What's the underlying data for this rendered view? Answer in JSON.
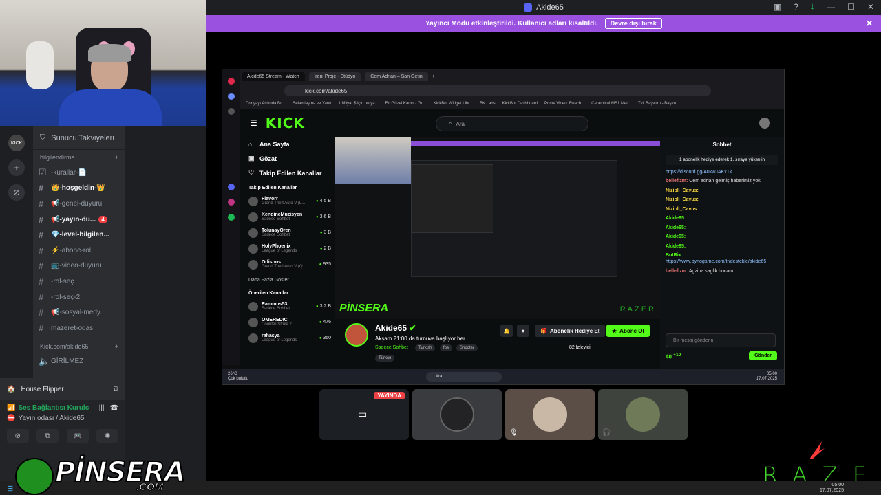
{
  "window": {
    "title": "Akide65"
  },
  "banner": {
    "text": "Yayıncı Modu etkinleştirildi. Kullanıcı adları kısaltıldı.",
    "button": "Devre dışı bırak"
  },
  "server": {
    "boost_label": "Sunucu Takviyeleri",
    "category1": "bilgilendirme",
    "category2": "Kick.com/akide65",
    "channels": [
      {
        "icon": "☑",
        "name": "-kurallar-📄",
        "bold": false
      },
      {
        "icon": "#",
        "name": "👑-hoşgeldin-👑",
        "bold": true
      },
      {
        "icon": "#",
        "name": "📢-genel-duyuru",
        "bold": false
      },
      {
        "icon": "#",
        "name": "📢-yayın-du...",
        "bold": true,
        "badge": "4"
      },
      {
        "icon": "#",
        "name": "💎-level-bilgilen...",
        "bold": true
      },
      {
        "icon": "#",
        "name": "⚡-abone-rol",
        "bold": false
      },
      {
        "icon": "#",
        "name": "📺-video-duyuru",
        "bold": false
      },
      {
        "icon": "#",
        "name": "-rol-seç",
        "bold": false
      },
      {
        "icon": "#",
        "name": "-rol-seç-2",
        "bold": false
      },
      {
        "icon": "#",
        "name": "📢-sosyal-medy...",
        "bold": false
      },
      {
        "icon": "#",
        "name": "mazeret-odası",
        "bold": false
      }
    ],
    "voice_channel": "GİRİLMEZ"
  },
  "voice_panel": {
    "activity": "House Flipper",
    "status": "Ses Bağlantısı Kurulc",
    "room": "Yayın odası / Akide65"
  },
  "browser": {
    "tabs": [
      "Akide65 Stream - Watch",
      "Yeni Proje - Stüdyo",
      "Cem Adrian – San Getin"
    ],
    "url": "kick.com/akide65",
    "bookmarks": [
      "Dunyayı Ardında Bır...",
      "Selamlaşma ve Yanıt",
      "1 Milyar $ için ne ya...",
      "En Güzel Kadın - Gu...",
      "KickBot Widget Libr...",
      "BK Labs",
      "KickBot Dashboard",
      "Prime Video: Reach...",
      "Ceramical MS1 Met...",
      "Tvll Başvuru - Başvu..."
    ]
  },
  "kick": {
    "logo": "KICK",
    "search_placeholder": "Ara",
    "nav": [
      "Ana Sayfa",
      "Gözat",
      "Takip Edilen Kanallar"
    ],
    "followed_title": "Takip Edilen Kanallar",
    "followed": [
      {
        "name": "Flavorr",
        "game": "Grand Theft Auto V (L...",
        "viewers": "4,5 B"
      },
      {
        "name": "KendineMuzisyen",
        "game": "Sadece Sohbet",
        "viewers": "3,6 B"
      },
      {
        "name": "TolunayOren",
        "game": "Sadece Sohbet",
        "viewers": "3 B"
      },
      {
        "name": "HolyPhoenix",
        "game": "League of Legends",
        "viewers": "2 B"
      },
      {
        "name": "Odisnos",
        "game": "Grand Theft Auto V (Q...",
        "viewers": "935"
      }
    ],
    "show_more": "Daha Fazla Göster",
    "recommended_title": "Önerilen Kanallar",
    "recommended": [
      {
        "name": "Rammus53",
        "game": "Sadece Sohbet",
        "viewers": "3,2 B"
      },
      {
        "name": "OMEREDIC",
        "game": "Counter-Strike 2",
        "viewers": "476"
      },
      {
        "name": "rahasya",
        "game": "League of Legends",
        "viewers": "360"
      }
    ],
    "stream": {
      "name": "Akide65",
      "title": "Akşam 21:00 da turnuva başlıyor her...",
      "category": "Sadece Sohbet",
      "tags": [
        "Turkish",
        "fps",
        "Shooter",
        "Türkçe"
      ],
      "gift_button": "Abonelik Hediye Et",
      "sub_button": "Abone Ol",
      "viewers": "82 İzleyici"
    },
    "chat": {
      "title": "Sohbet",
      "pinned": "1 abonelik hediye ederek 1. sıraya yükselin",
      "messages": [
        {
          "user": "",
          "text": "https://discord.gg/AukwJAKxTk",
          "color": "#6ab0ff"
        },
        {
          "user": "bellefizm:",
          "text": "Cem adrian gelmiş haberimiz yok",
          "color": "#e77"
        },
        {
          "user": "Nizipli_Cavus:",
          "text": "",
          "color": "#f5d442"
        },
        {
          "user": "Nizipli_Cavus:",
          "text": "",
          "color": "#f5d442"
        },
        {
          "user": "Nizipli_Cavus:",
          "text": "",
          "color": "#f5d442"
        },
        {
          "user": "Akide65:",
          "text": "",
          "color": "#53fc18"
        },
        {
          "user": "Akide65:",
          "text": "",
          "color": "#53fc18"
        },
        {
          "user": "Akide65:",
          "text": "",
          "color": "#53fc18"
        },
        {
          "user": "Akide65:",
          "text": "",
          "color": "#53fc18"
        },
        {
          "user": "BotRix:",
          "text": "https://www.bynogame.com/tr/destekle/akide65",
          "color": "#53fc18"
        },
        {
          "user": "bellefizm:",
          "text": "Agzina saglik hocam",
          "color": "#e77"
        }
      ],
      "input_placeholder": "Bir mesaj gönderin",
      "points": "40",
      "points_bonus": "+10",
      "send": "Gönder"
    },
    "taskbar": {
      "temp": "26°C",
      "weather": "Çok bulutlu",
      "search": "Ara",
      "time": "05:00",
      "date": "17.07.2025"
    }
  },
  "tiles": {
    "live": "YAYINDA"
  },
  "overlay": {
    "razer": "RAZER",
    "pinsera": "PİNSERA",
    "pinsera_domain": ".COM"
  },
  "win_taskbar": {
    "time": "05:00",
    "date": "17.07.2025"
  },
  "colors": {
    "accent": "#9b51e0",
    "kick": "#53fc18",
    "razer": "#44d62c"
  }
}
